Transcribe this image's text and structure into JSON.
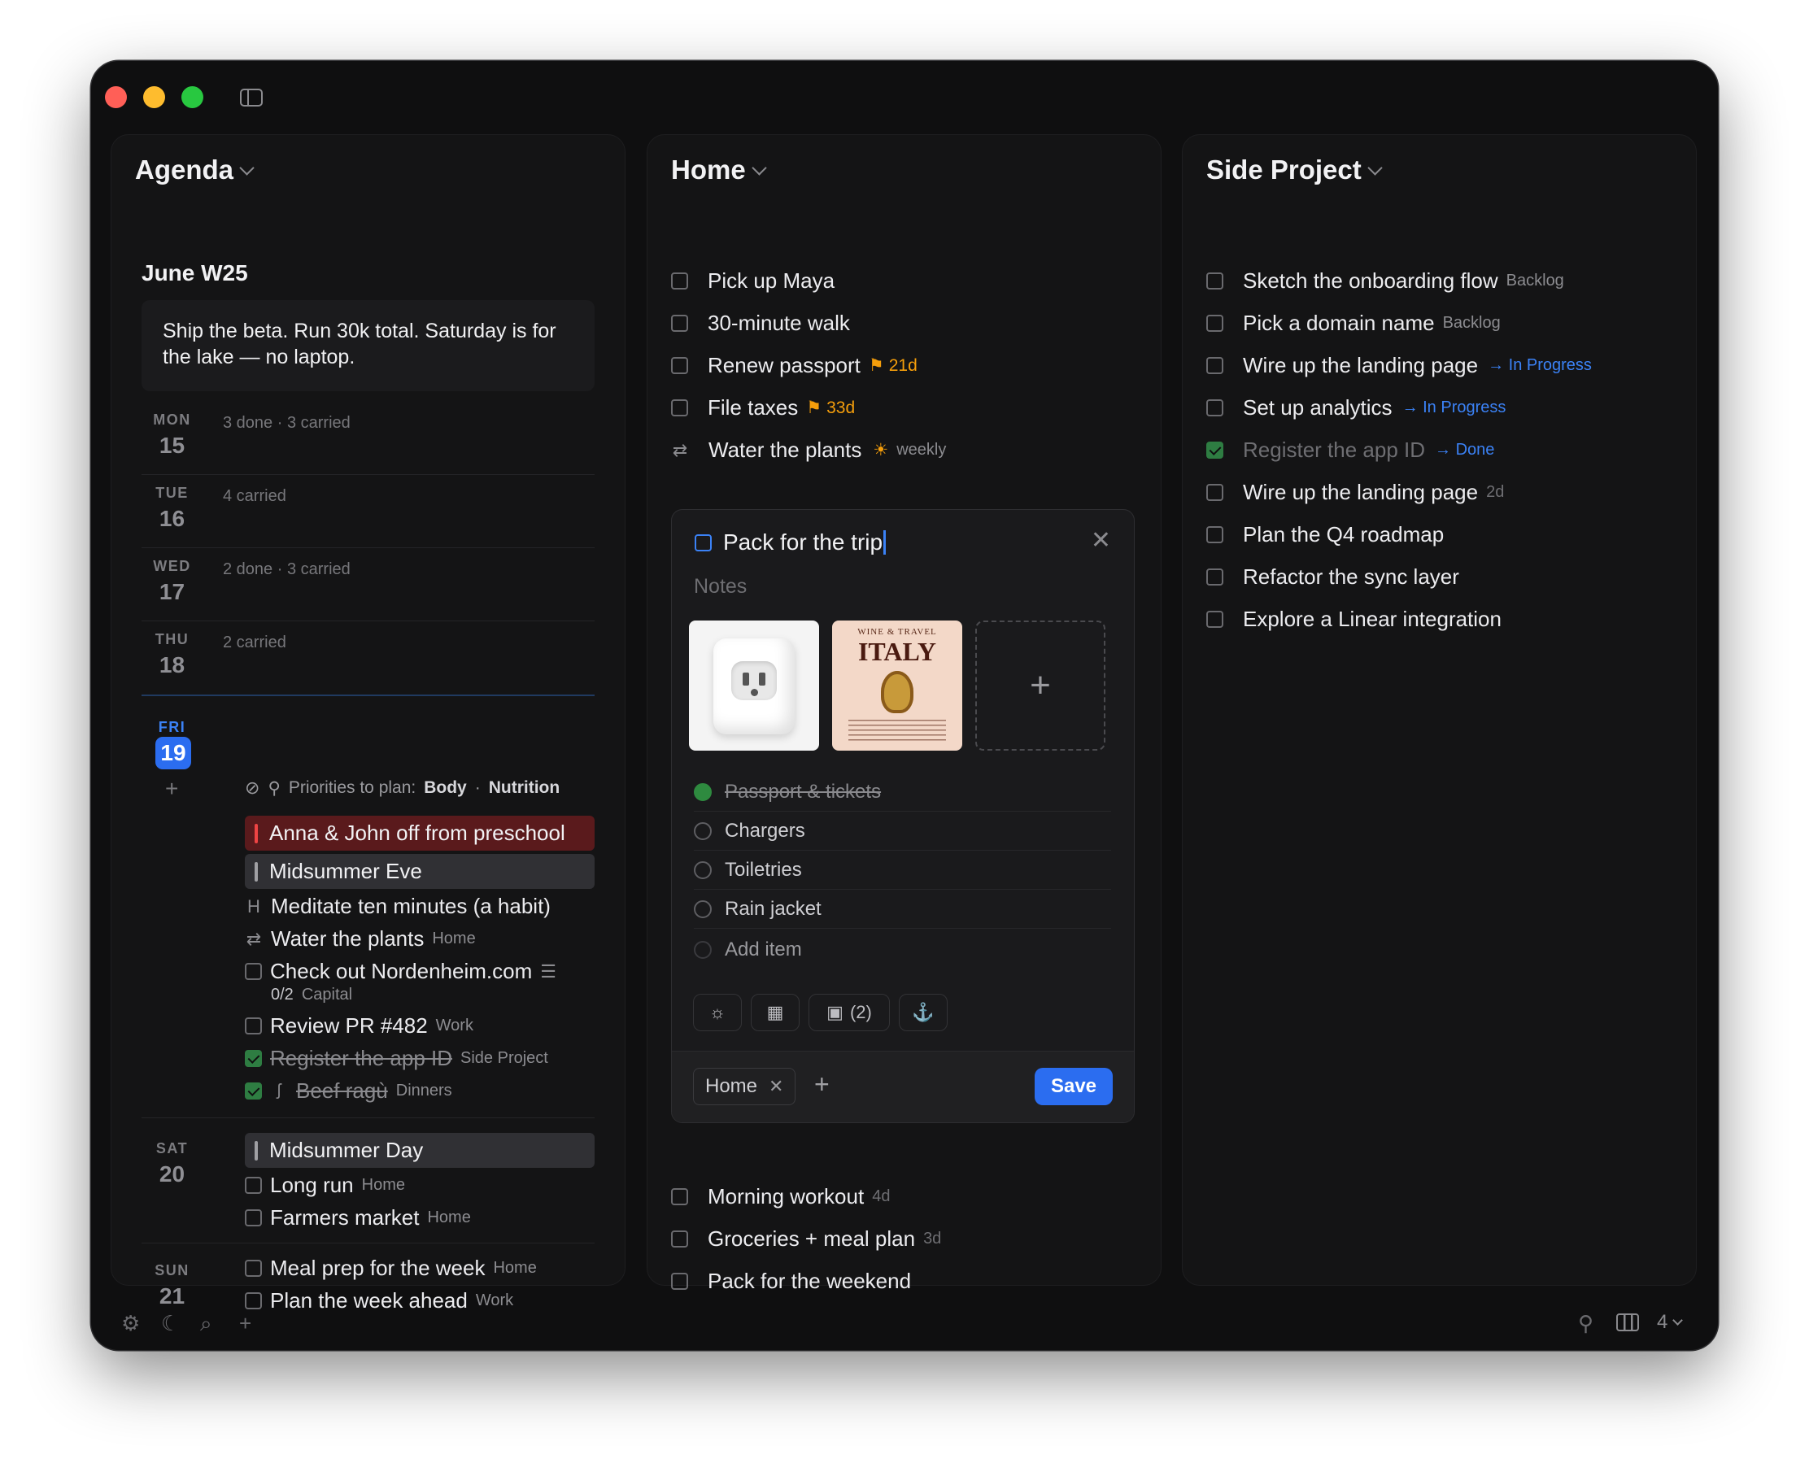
{
  "agenda": {
    "title": "Agenda",
    "week_title": "June W25",
    "week_note": "Ship the beta. Run 30k total. Saturday is for the lake — no laptop.",
    "days": [
      {
        "name": "MON",
        "num": "15",
        "summary": "3 done · 3 carried"
      },
      {
        "name": "TUE",
        "num": "16",
        "summary": "4 carried"
      },
      {
        "name": "WED",
        "num": "17",
        "summary": "2 done · 3 carried"
      },
      {
        "name": "THU",
        "num": "18",
        "summary": "2 carried"
      }
    ],
    "friday": {
      "name": "FRI",
      "num": "19",
      "priorities_label": "Priorities to plan:",
      "priority_1": "Body",
      "priority_sep": "·",
      "priority_2": "Nutrition",
      "event_red": "Anna & John off from preschool",
      "event_gray": "Midsummer Eve",
      "habit_letter": "H",
      "habit": "Meditate ten minutes (a habit)",
      "water": "Water the plants",
      "water_tag": "Home",
      "nord": "Check out Nordenheim.com",
      "nord_progress": "0/2",
      "nord_tag": "Capital",
      "pr": "Review PR #482",
      "pr_tag": "Work",
      "appid": "Register the app ID",
      "appid_tag": "Side Project",
      "ragu": "Beef ragù",
      "ragu_tag": "Dinners"
    },
    "saturday": {
      "name": "SAT",
      "num": "20",
      "event": "Midsummer Day",
      "run": "Long run",
      "run_tag": "Home",
      "market": "Farmers market",
      "market_tag": "Home"
    },
    "sunday": {
      "name": "SUN",
      "num": "21",
      "meal": "Meal prep for the week",
      "meal_tag": "Home",
      "plan": "Plan the week ahead",
      "plan_tag": "Work"
    }
  },
  "home": {
    "title": "Home",
    "tasks": [
      {
        "label": "Pick up Maya"
      },
      {
        "label": "30-minute walk"
      },
      {
        "label": "Renew passport",
        "due": "21d"
      },
      {
        "label": "File taxes",
        "due": "33d"
      },
      {
        "label": "Water the plants",
        "repeat": "weekly"
      }
    ],
    "bottom_tasks": [
      {
        "label": "Morning workout",
        "age": "4d"
      },
      {
        "label": "Groceries + meal plan",
        "age": "3d"
      },
      {
        "label": "Pack for the weekend"
      }
    ],
    "editor": {
      "title": "Pack for the trip",
      "notes_placeholder": "Notes",
      "book_small": "WINE & TRAVEL",
      "book_big": "ITALY",
      "subtasks": [
        {
          "label": "Passport & tickets",
          "done": true
        },
        {
          "label": "Chargers",
          "done": false
        },
        {
          "label": "Toiletries",
          "done": false
        },
        {
          "label": "Rain jacket",
          "done": false
        }
      ],
      "add_item": "Add item",
      "images_count": "(2)",
      "chip": "Home",
      "save_label": "Save"
    }
  },
  "side_project": {
    "title": "Side Project",
    "tasks": [
      {
        "label": "Sketch the onboarding flow",
        "status": "Backlog"
      },
      {
        "label": "Pick a domain name",
        "status": "Backlog"
      },
      {
        "label": "Wire up the landing page",
        "status": "→ In Progress"
      },
      {
        "label": "Set up analytics",
        "status": "→ In Progress"
      },
      {
        "label": "Register the app ID",
        "status": "→ Done",
        "done": true
      },
      {
        "label": "Wire up the landing page",
        "age": "2d"
      },
      {
        "label": "Plan the Q4 roadmap"
      },
      {
        "label": "Refactor the sync layer"
      },
      {
        "label": "Explore a Linear integration"
      }
    ]
  },
  "footer": {
    "column_count": "4"
  },
  "colors": {
    "accent": "#2b6df0",
    "event_red": "#5a1a1c",
    "due_orange": "#f59e0b",
    "done_green": "#2e7d42"
  }
}
